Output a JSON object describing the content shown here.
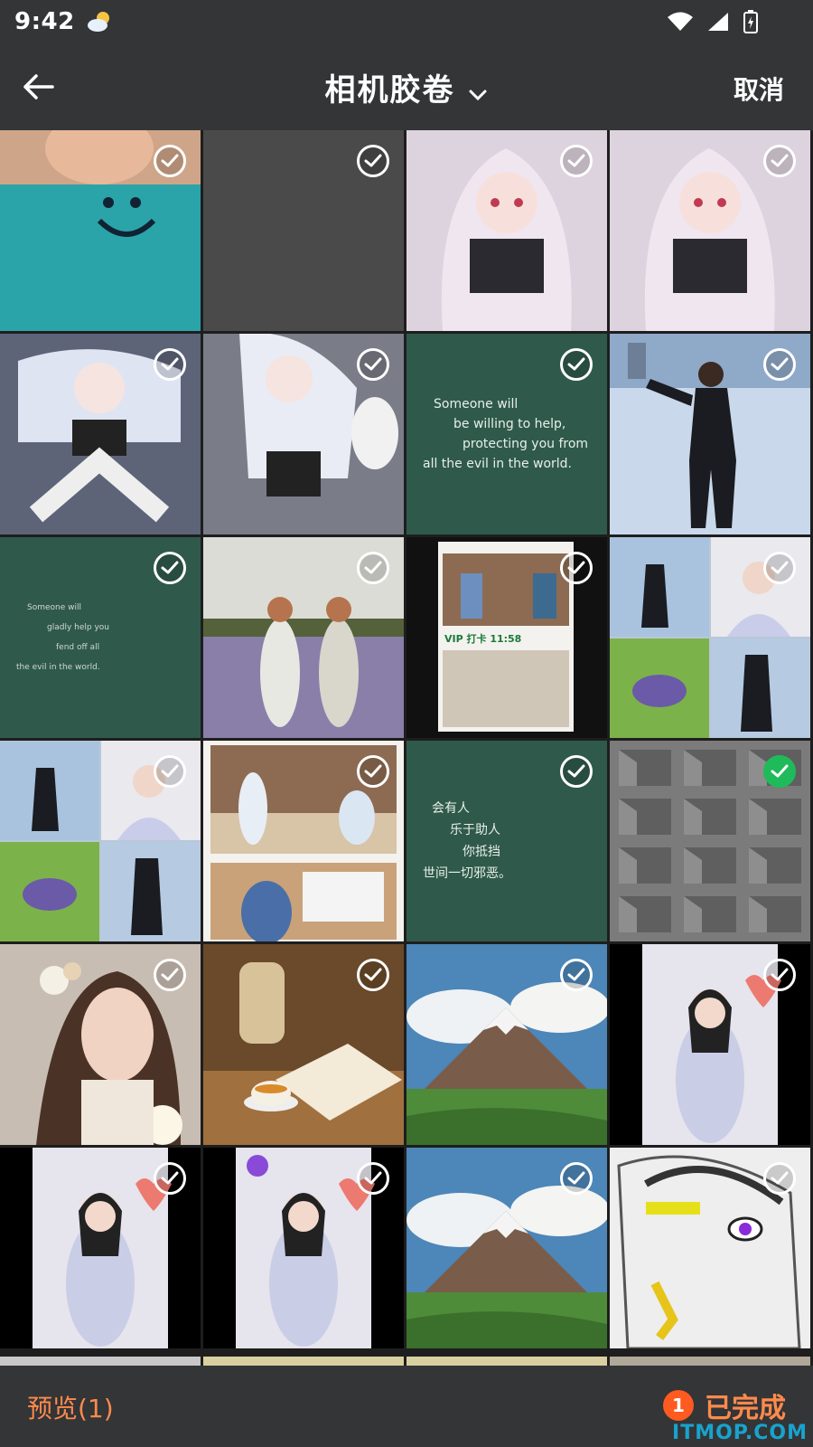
{
  "status_bar": {
    "time": "9:42",
    "weather_icon": "partly-cloudy-icon",
    "wifi_icon": "wifi-icon",
    "signal_icon": "signal-icon",
    "battery_icon": "battery-charging-icon"
  },
  "header": {
    "title": "相机胶卷",
    "cancel_label": "取消"
  },
  "tiles": [
    {
      "scene": "kid-in-blue-shirt",
      "selected": false,
      "bg": "#2aa4a8",
      "overlay_text": ""
    },
    {
      "scene": "blank-gray",
      "selected": false,
      "bg": "#4a4a4a",
      "overlay_text": ""
    },
    {
      "scene": "anime-girl-white-hair",
      "selected": false,
      "bg": "#d9cfd9",
      "overlay_text": ""
    },
    {
      "scene": "anime-girl-white-hair",
      "selected": false,
      "bg": "#d9cfd9",
      "overlay_text": ""
    },
    {
      "scene": "anime-girl-sitting",
      "selected": false,
      "bg": "#6a7289",
      "overlay_text": ""
    },
    {
      "scene": "anime-girl-with-dog",
      "selected": false,
      "bg": "#8a8c98",
      "overlay_text": ""
    },
    {
      "scene": "green-quote",
      "selected": false,
      "bg": "#2f5a4b",
      "overlay_text": ""
    },
    {
      "scene": "person-in-snow",
      "selected": false,
      "bg": "#9fb4cf",
      "overlay_text": ""
    },
    {
      "scene": "green-quote-small",
      "selected": false,
      "bg": "#2f5a4b",
      "overlay_text": ""
    },
    {
      "scene": "two-girls-in-field",
      "selected": false,
      "bg": "#9aa38c",
      "overlay_text": ""
    },
    {
      "scene": "library-collage",
      "selected": false,
      "bg": "#111111",
      "overlay_text": "VIP 打卡 11:58"
    },
    {
      "scene": "snow-and-girl-collage",
      "selected": false,
      "bg": "#b9c7d8",
      "overlay_text": ""
    },
    {
      "scene": "snow-and-girl-collage",
      "selected": false,
      "bg": "#b9c7d8",
      "overlay_text": ""
    },
    {
      "scene": "library-people",
      "selected": false,
      "bg": "#c9b08c",
      "overlay_text": ""
    },
    {
      "scene": "green-quote-cn",
      "selected": false,
      "bg": "#2f5a4b",
      "overlay_text": ""
    },
    {
      "scene": "concrete-building",
      "selected": true,
      "bg": "#7b7b7b",
      "overlay_text": ""
    },
    {
      "scene": "girl-with-flowers",
      "selected": false,
      "bg": "#c7b3a6",
      "overlay_text": ""
    },
    {
      "scene": "book-and-tea",
      "selected": false,
      "bg": "#8a6a44",
      "overlay_text": ""
    },
    {
      "scene": "mountain-landscape",
      "selected": false,
      "bg": "#5c8fb8",
      "overlay_text": ""
    },
    {
      "scene": "girl-with-heart",
      "selected": false,
      "bg": "#000000",
      "overlay_text": ""
    },
    {
      "scene": "girl-with-heart",
      "selected": false,
      "bg": "#000000",
      "overlay_text": ""
    },
    {
      "scene": "girl-with-heart-flower",
      "selected": false,
      "bg": "#000000",
      "overlay_text": ""
    },
    {
      "scene": "mountain-landscape",
      "selected": false,
      "bg": "#5c8fb8",
      "overlay_text": ""
    },
    {
      "scene": "sketch-girl",
      "selected": false,
      "bg": "#e2e2e2",
      "overlay_text": ""
    }
  ],
  "quotes": {
    "en": [
      "Someone will",
      "be willing to help,",
      "protecting you from",
      "all the evil in the world."
    ],
    "en_small": [
      "Someone will",
      "gladly help you",
      "fend off all",
      "the evil in the world."
    ],
    "cn": [
      "会有人",
      "乐于助人",
      "你抵挡",
      "世间一切邪恶。"
    ]
  },
  "bottom_bar": {
    "preview_label": "预览(1)",
    "selected_count": "1",
    "done_label": "已完成"
  },
  "watermark": "ITMOP.COM",
  "colors": {
    "accent": "#ff8a4c",
    "check_on": "#1fba5a",
    "bar": "#333537"
  }
}
